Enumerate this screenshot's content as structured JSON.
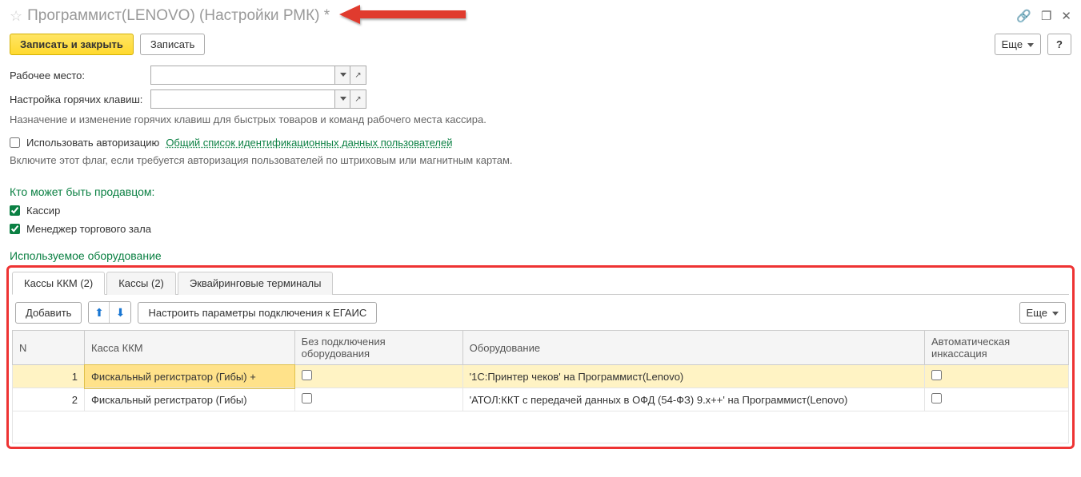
{
  "header": {
    "title": "Программист(LENOVO) (Настройки РМК) *"
  },
  "toolbar": {
    "save_close": "Записать и закрыть",
    "save": "Записать",
    "more": "Еще",
    "help": "?"
  },
  "form": {
    "workplace_label": "Рабочее место:",
    "hotkeys_label": "Настройка горячих клавиш:",
    "hotkeys_hint": "Назначение и изменение горячих клавиш для быстрых товаров и команд рабочего места кассира."
  },
  "auth": {
    "checkbox_label": "Использовать авторизацию",
    "link_text": "Общий список идентификационных данных пользователей",
    "hint": "Включите этот флаг, если требуется авторизация пользователей по штриховым или магнитным картам."
  },
  "sellers": {
    "title": "Кто может быть продавцом:",
    "cashier": "Кассир",
    "manager": "Менеджер торгового зала"
  },
  "equipment": {
    "title": "Используемое оборудование",
    "tabs": [
      {
        "label": "Кассы ККМ (2)",
        "active": true
      },
      {
        "label": "Кассы (2)",
        "active": false
      },
      {
        "label": "Эквайринговые терминалы",
        "active": false
      }
    ],
    "tab_toolbar": {
      "add": "Добавить",
      "egais": "Настроить параметры подключения к ЕГАИС",
      "more": "Еще"
    },
    "columns": {
      "n": "N",
      "kkm": "Касса ККМ",
      "noconn": "Без подключения оборудования",
      "device": "Оборудование",
      "auto": "Автоматическая инкассация"
    },
    "rows": [
      {
        "n": "1",
        "kkm": "Фискальный регистратор (Гибы) +",
        "noconn": false,
        "device": "'1С:Принтер чеков' на Программист(Lenovo)",
        "auto": false,
        "selected": true
      },
      {
        "n": "2",
        "kkm": "Фискальный регистратор (Гибы)",
        "noconn": false,
        "device": "'АТОЛ:ККТ с передачей данных в ОФД (54-ФЗ) 9.x++' на Программист(Lenovo)",
        "auto": false,
        "selected": false
      }
    ]
  }
}
